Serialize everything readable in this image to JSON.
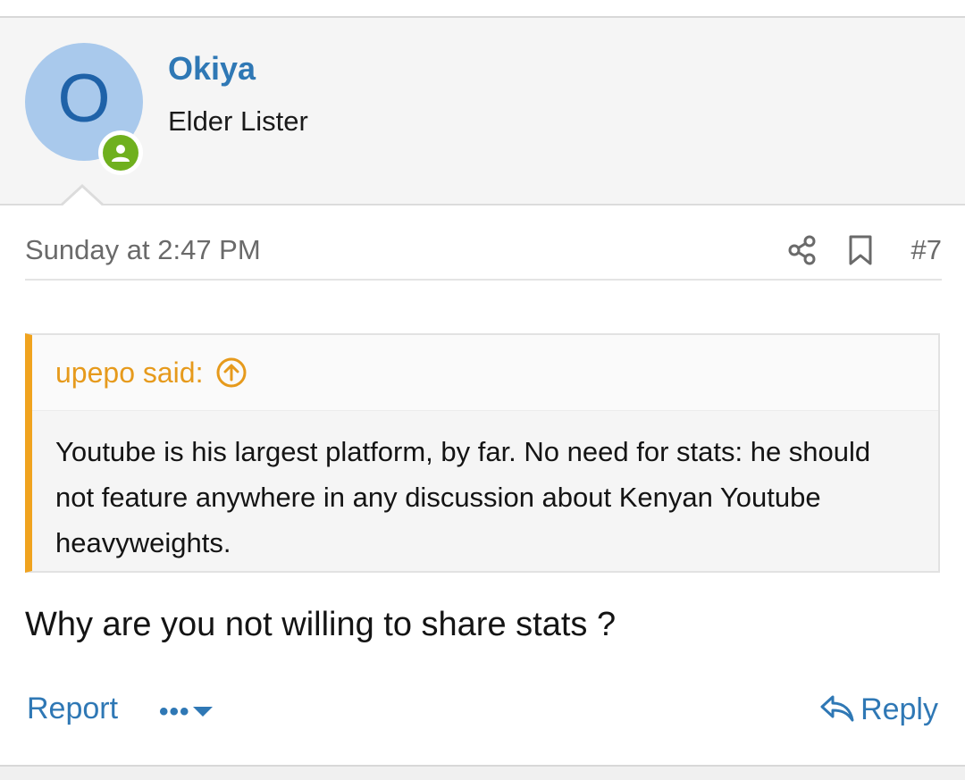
{
  "author": {
    "avatar_letter": "O",
    "name": "Okiya",
    "title": "Elder Lister",
    "avatar_color": "#a9c9ec",
    "online_color": "#6fb01e"
  },
  "post": {
    "date": "Sunday at 2:47 PM",
    "number": "#7",
    "body": "Why are you not willing to share stats ?"
  },
  "quote": {
    "author_label": "upepo said:",
    "text": "Youtube is his largest platform, by far. No need for stats: he should not feature anywhere in any discussion about Kenyan Youtube heavyweights.",
    "accent_color": "#f0a31f"
  },
  "actions": {
    "report_label": "Report",
    "more_label": "•••",
    "reply_label": "Reply"
  },
  "icons": {
    "share": "share-icon",
    "bookmark": "bookmark-icon",
    "quote_up": "arrow-up-circle-icon",
    "more_caret": "caret-down-icon",
    "reply": "reply-icon",
    "online": "user-online-icon"
  },
  "colors": {
    "link": "#2f78b5",
    "muted": "#6a6a6a"
  }
}
